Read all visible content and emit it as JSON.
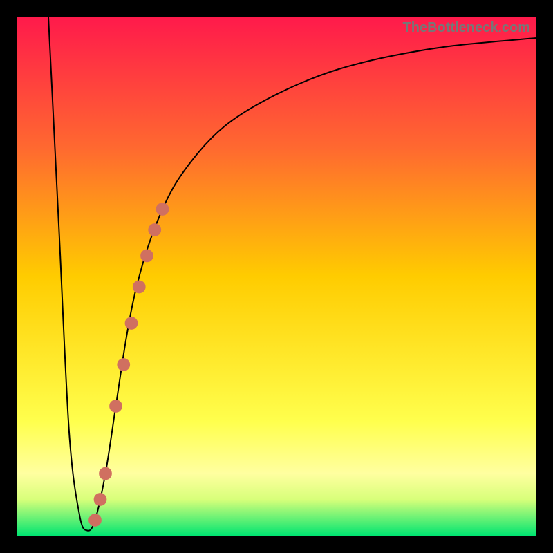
{
  "watermark": "TheBottleneck.com",
  "chart_data": {
    "type": "line",
    "title": "",
    "xlabel": "",
    "ylabel": "",
    "xlim": [
      0,
      100
    ],
    "ylim": [
      0,
      100
    ],
    "gradient_stops": [
      {
        "pct": 0,
        "color": "#ff1a4b"
      },
      {
        "pct": 25,
        "color": "#ff6830"
      },
      {
        "pct": 50,
        "color": "#ffcc00"
      },
      {
        "pct": 78,
        "color": "#ffff4d"
      },
      {
        "pct": 88,
        "color": "#ffffa0"
      },
      {
        "pct": 93,
        "color": "#d8ff7a"
      },
      {
        "pct": 100,
        "color": "#00e571"
      }
    ],
    "series": [
      {
        "name": "bottleneck-curve",
        "x": [
          6,
          8,
          10,
          12,
          13.5,
          15,
          17,
          19,
          21,
          23,
          26,
          30,
          35,
          40,
          46,
          54,
          62,
          72,
          84,
          100
        ],
        "y": [
          100,
          60,
          20,
          4,
          1,
          3,
          12,
          25,
          38,
          48,
          58,
          67,
          74,
          79,
          83,
          87,
          90,
          92.5,
          94.5,
          96
        ]
      }
    ],
    "highlight_segment": {
      "name": "highlight-dots",
      "color": "#d07060",
      "x": [
        15,
        16,
        17,
        19,
        20.5,
        22,
        23.5,
        25,
        26.5,
        28
      ],
      "y": [
        3,
        7,
        12,
        25,
        33,
        41,
        48,
        54,
        59,
        63
      ]
    },
    "annotations": []
  }
}
